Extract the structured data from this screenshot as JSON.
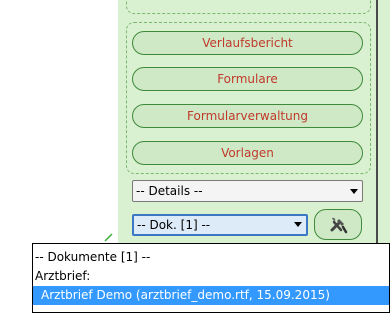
{
  "nav": {
    "buttons": [
      {
        "label": "Verlaufsbericht"
      },
      {
        "label": "Formulare"
      },
      {
        "label": "Formularverwaltung"
      },
      {
        "label": "Vorlagen"
      }
    ]
  },
  "details_select": {
    "value": "-- Details --"
  },
  "dok_select": {
    "value": "-- Dok. [1] --"
  },
  "dropdown": {
    "header": "-- Dokumente [1] --",
    "group_label": "Arztbrief:",
    "selected_option": "Arztbrief Demo (arztbrief_demo.rtf, 15.09.2015)"
  },
  "colors": {
    "panel_bg": "#d9f0d1",
    "button_bg": "#cfe9c6",
    "button_border": "#3f8a3a",
    "button_text": "#c0392b",
    "selection": "#3399ff"
  },
  "icons": {
    "tools": "tools-icon",
    "dropdown_arrow": "chevron-down-icon"
  }
}
